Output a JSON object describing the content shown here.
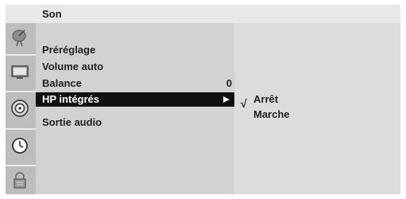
{
  "menu": {
    "title": "Son",
    "items": [
      {
        "label": "Préréglage",
        "value": ""
      },
      {
        "label": "Volume auto",
        "value": ""
      },
      {
        "label": "Balance",
        "value": "0"
      },
      {
        "label": "HP intégrés",
        "value": ""
      },
      {
        "label": "Sortie audio",
        "value": ""
      }
    ],
    "selected_index": 3
  },
  "submenu": {
    "check_mark": "√",
    "options": [
      "Arrêt",
      "Marche"
    ],
    "checked_index": 0
  },
  "sidebar": {
    "icons": [
      "satellite-dish-icon",
      "tv-screen-icon",
      "speaker-icon",
      "clock-icon",
      "lock-icon"
    ],
    "active_icon": "speaker-icon"
  },
  "colors": {
    "panel": "#d2d2d2",
    "title_bar": "#e8e8e8",
    "icon_bar": "#bdbdbd",
    "submenu_panel": "#dcdcdc",
    "selection": "#111111"
  }
}
